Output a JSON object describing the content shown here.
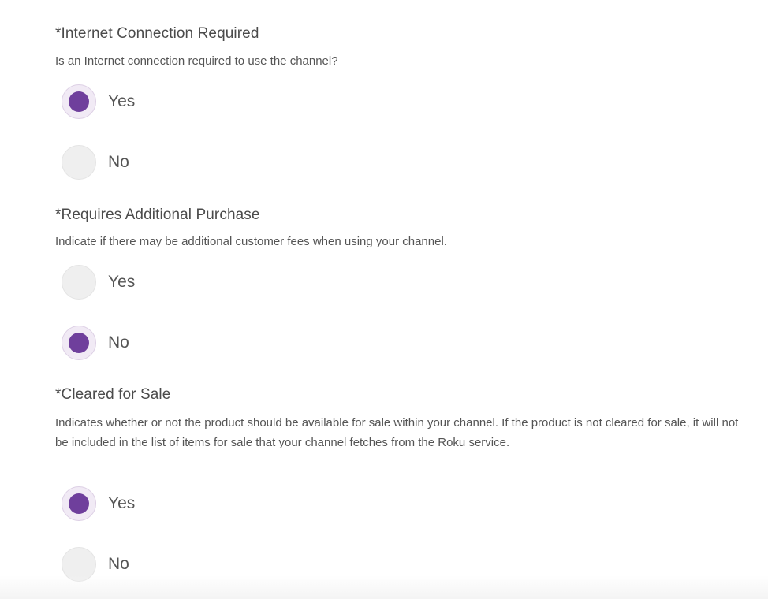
{
  "sections": [
    {
      "title": "*Internet Connection Required",
      "description": "Is an Internet connection required to use the channel?",
      "options": [
        {
          "label": "Yes",
          "selected": true
        },
        {
          "label": "No",
          "selected": false
        }
      ]
    },
    {
      "title": "*Requires Additional Purchase",
      "description": "Indicate if there may be additional customer fees when using your channel.",
      "options": [
        {
          "label": "Yes",
          "selected": false
        },
        {
          "label": "No",
          "selected": true
        }
      ]
    },
    {
      "title": "*Cleared for Sale",
      "description": "Indicates whether or not the product should be available for sale within your channel. If the product is not cleared for sale, it will not be included in the list of items for sale that your channel fetches from the Roku service.",
      "options": [
        {
          "label": "Yes",
          "selected": true
        },
        {
          "label": "No",
          "selected": false
        }
      ]
    }
  ],
  "colors": {
    "accent": "#6f3f9c",
    "radio_bg": "#efefef",
    "radio_checked_bg": "#f1eaf5"
  }
}
